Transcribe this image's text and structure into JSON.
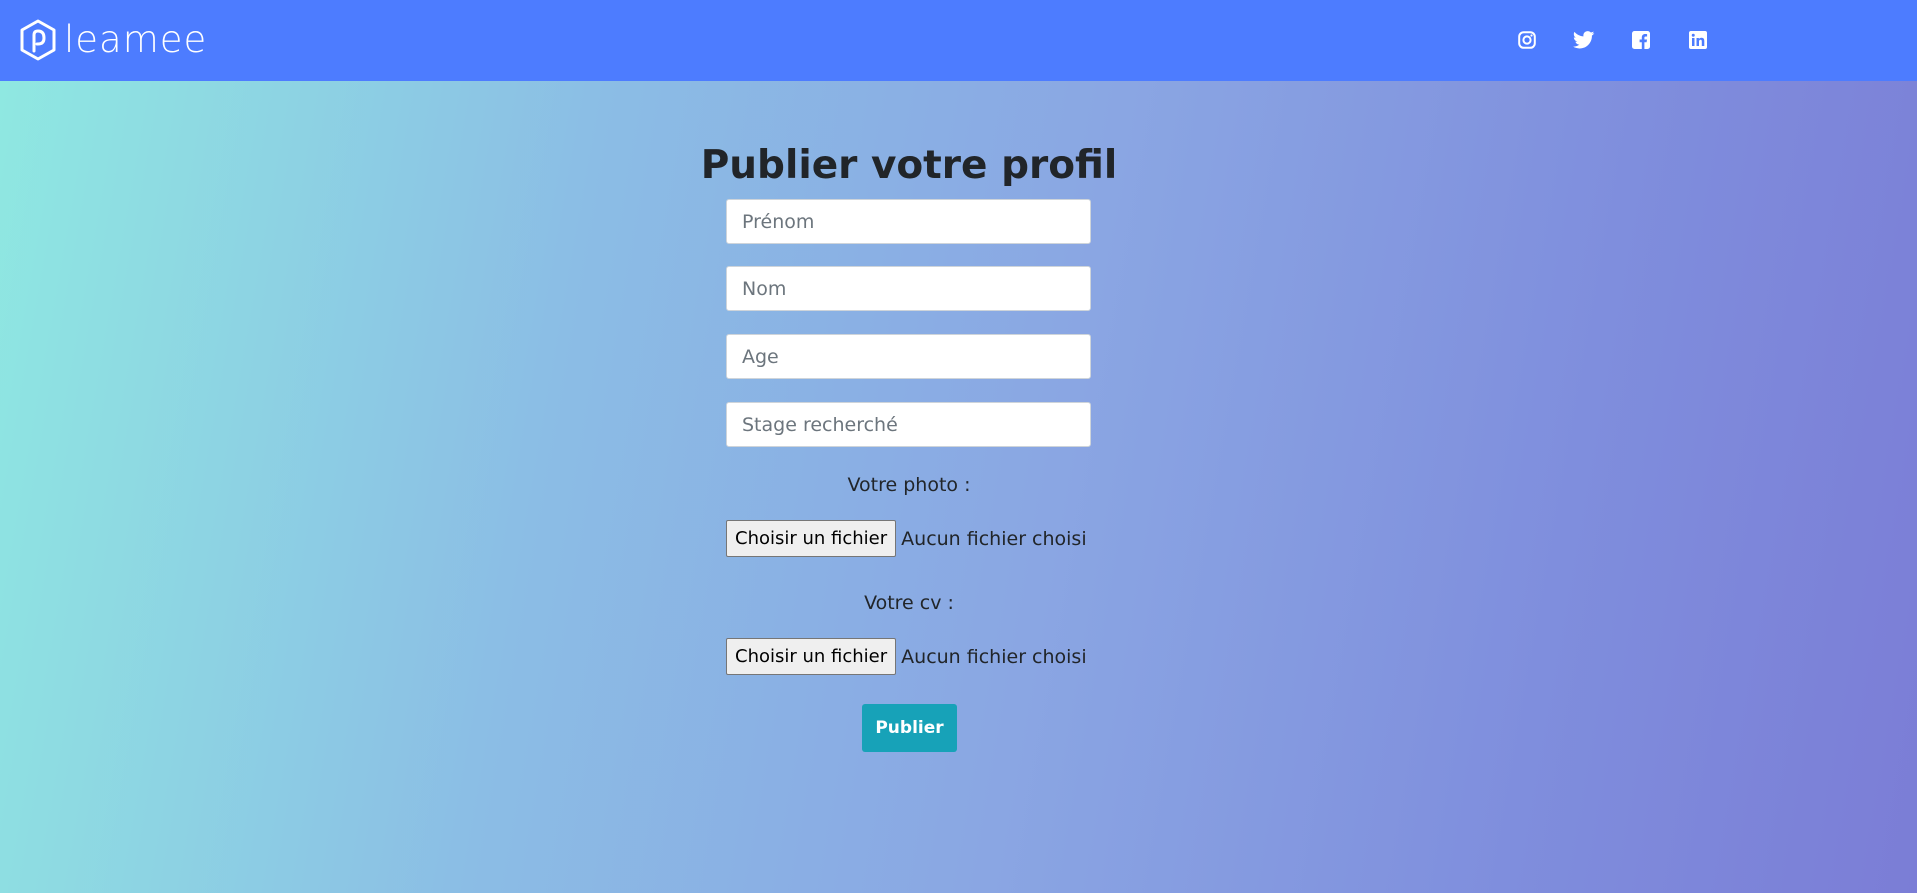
{
  "navbar": {
    "brand_name": "leamee",
    "socials": [
      {
        "icon": "instagram-icon"
      },
      {
        "icon": "twitter-icon"
      },
      {
        "icon": "facebook-icon"
      },
      {
        "icon": "linkedin-icon"
      }
    ]
  },
  "form": {
    "title": "Publier votre profil",
    "fields": {
      "first_name": {
        "placeholder": "Prénom",
        "value": ""
      },
      "last_name": {
        "placeholder": "Nom",
        "value": ""
      },
      "age": {
        "placeholder": "Age",
        "value": ""
      },
      "internship": {
        "placeholder": "Stage recherché",
        "value": ""
      }
    },
    "photo": {
      "label": "Votre photo :",
      "button_label": "Choisir un fichier",
      "status": "Aucun fichier choisi"
    },
    "cv": {
      "label": "Votre cv :",
      "button_label": "Choisir un fichier",
      "status": "Aucun fichier choisi"
    },
    "submit_label": "Publier"
  },
  "colors": {
    "navbar": "#4d7cff",
    "submit": "#17a2b8",
    "gradient_start": "#8fe9e1",
    "gradient_end": "#7b7dd6"
  }
}
